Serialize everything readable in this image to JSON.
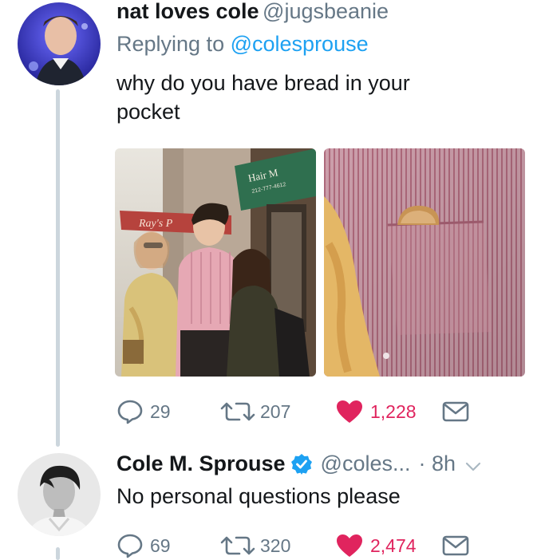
{
  "tweet1": {
    "display_name": "nat loves cole",
    "handle": "@jugsbeanie",
    "replying_prefix": "Replying to",
    "replying_handle": "@colesprouse",
    "text_line1": "why do you have bread in your",
    "text_line2": "pocket",
    "photo1_signs": [
      "Ray's P",
      "Hair M",
      "212-777-4612"
    ],
    "actions": {
      "replies": "29",
      "retweets": "207",
      "likes": "1,228"
    }
  },
  "tweet2": {
    "display_name": "Cole M. Sprouse",
    "handle": "@coles...",
    "time": "· 8h",
    "text": "No personal questions please",
    "actions": {
      "replies": "69",
      "retweets": "320",
      "likes": "2,474"
    }
  },
  "icons": {
    "reply": "speech-bubble-icon",
    "retweet": "retweet-arrows-icon",
    "like": "heart-icon",
    "dm": "envelope-icon",
    "verified": "verified-badge-icon",
    "more": "chevron-down-icon"
  },
  "colors": {
    "accent": "#1da1f2",
    "like": "#e0245e",
    "muted": "#657786",
    "text": "#14171a"
  }
}
